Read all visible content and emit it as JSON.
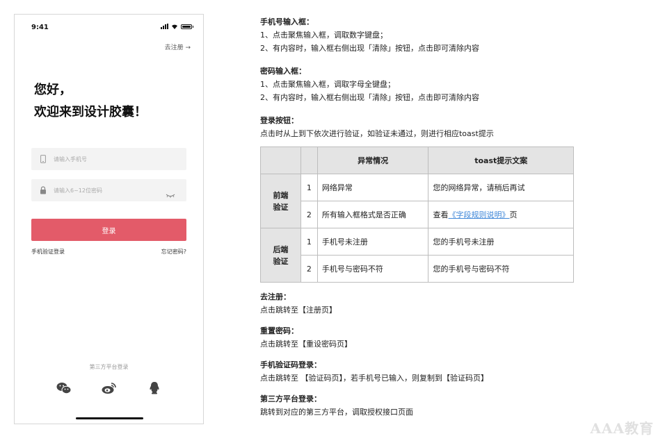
{
  "phone": {
    "status_time": "9:41",
    "go_register": "去注册 →",
    "greeting_1": "您好，",
    "greeting_2": "欢迎来到设计胶囊！",
    "phone_placeholder": "请输入手机号",
    "password_placeholder": "请输入6~12位密码",
    "login_label": "登录",
    "sms_login": "手机验证登录",
    "forgot_password": "忘记密码?",
    "third_party_label": "第三方平台登录",
    "accent_color": "#e35b69",
    "third_party_icons": [
      "wechat-icon",
      "weibo-icon",
      "qq-icon"
    ]
  },
  "notes": {
    "phone_field": {
      "title": "手机号输入框：",
      "line1": "1、点击聚焦输入框，调取数字键盘；",
      "line2": "2、有内容时，输入框右侧出现「清除」按钮，点击即可清除内容"
    },
    "password_field": {
      "title": "密码输入框：",
      "line1": "1、点击聚焦输入框，调取字母全键盘；",
      "line2": "2、有内容时，输入框右侧出现「清除」按钮，点击即可清除内容"
    },
    "login_button": {
      "title": "登录按钮：",
      "line1": "点击时从上到下依次进行验证，如验证未通过，则进行相应toast提示"
    },
    "register": {
      "title": "去注册：",
      "line1": "点击跳转至【注册页】"
    },
    "reset": {
      "title": "重置密码：",
      "line1": "点击跳转至【重设密码页】"
    },
    "sms": {
      "title": "手机验证码登录：",
      "line1": "点击跳转至 【验证码页】，若手机号已输入，则复制到【验证码页】"
    },
    "third": {
      "title": "第三方平台登录：",
      "line1": "跳转到对应的第三方平台，调取授权接口页面"
    }
  },
  "table": {
    "headers": {
      "condition": "异常情况",
      "toast": "toast提示文案"
    },
    "front": {
      "group_1": "前端",
      "group_2": "验证",
      "rows": [
        {
          "num": "1",
          "condition": "网络异常",
          "toast": "您的网络异常，请稍后再试"
        },
        {
          "num": "2",
          "condition": "所有输入框格式是否正确",
          "toast_pre": "查看",
          "toast_link": "《字段规则说明》",
          "toast_post": "页"
        }
      ]
    },
    "back": {
      "group_1": "后端",
      "group_2": "验证",
      "rows": [
        {
          "num": "1",
          "condition": "手机号未注册",
          "toast": "您的手机号未注册"
        },
        {
          "num": "2",
          "condition": "手机号与密码不符",
          "toast": "您的手机号与密码不符"
        }
      ]
    }
  },
  "watermark": "AAA教育"
}
